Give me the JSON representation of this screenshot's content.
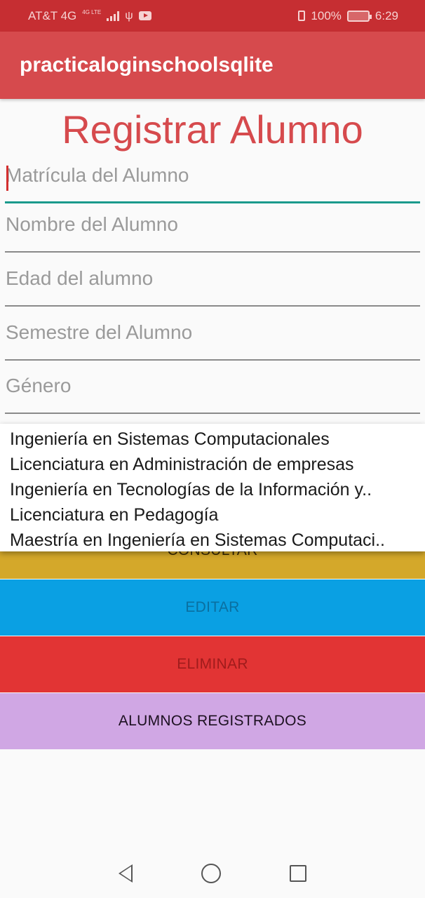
{
  "status_bar": {
    "carrier": "AT&T 4G",
    "network_tag": "4G LTE",
    "battery": "100%",
    "time": "6:29"
  },
  "app_bar": {
    "title": "practicaloginschoolsqlite"
  },
  "page": {
    "title": "Registrar Alumno"
  },
  "form": {
    "matricula_placeholder": "Matrícula del Alumno",
    "nombre_placeholder": "Nombre del Alumno",
    "edad_placeholder": "Edad del alumno",
    "semestre_placeholder": "Semestre del Alumno",
    "genero_placeholder": "Género"
  },
  "dropdown": {
    "items": [
      "Ingeniería en Sistemas Computacionales",
      "Licenciatura en Administración de empresas",
      "Ingeniería en Tecnologías de la Información y..",
      "Licenciatura en Pedagogía",
      "Maestría en Ingeniería en Sistemas Computaci.."
    ]
  },
  "buttons": {
    "consultar": "CONSULTAR",
    "editar": "EDITAR",
    "eliminar": "ELIMINAR",
    "alumnos": "ALUMNOS REGISTRADOS"
  },
  "colors": {
    "status_bar": "#c62e32",
    "app_bar": "#d64a4d",
    "consultar": "#d4a82a",
    "editar": "#0aa0e3",
    "eliminar": "#e23434",
    "alumnos": "#d0a7e4",
    "focus_underline": "#1a9a8c"
  },
  "icons": [
    "signal-icon",
    "usb-icon",
    "youtube-icon",
    "vibrate-icon",
    "battery-icon",
    "nav-back-icon",
    "nav-home-icon",
    "nav-recent-icon"
  ]
}
